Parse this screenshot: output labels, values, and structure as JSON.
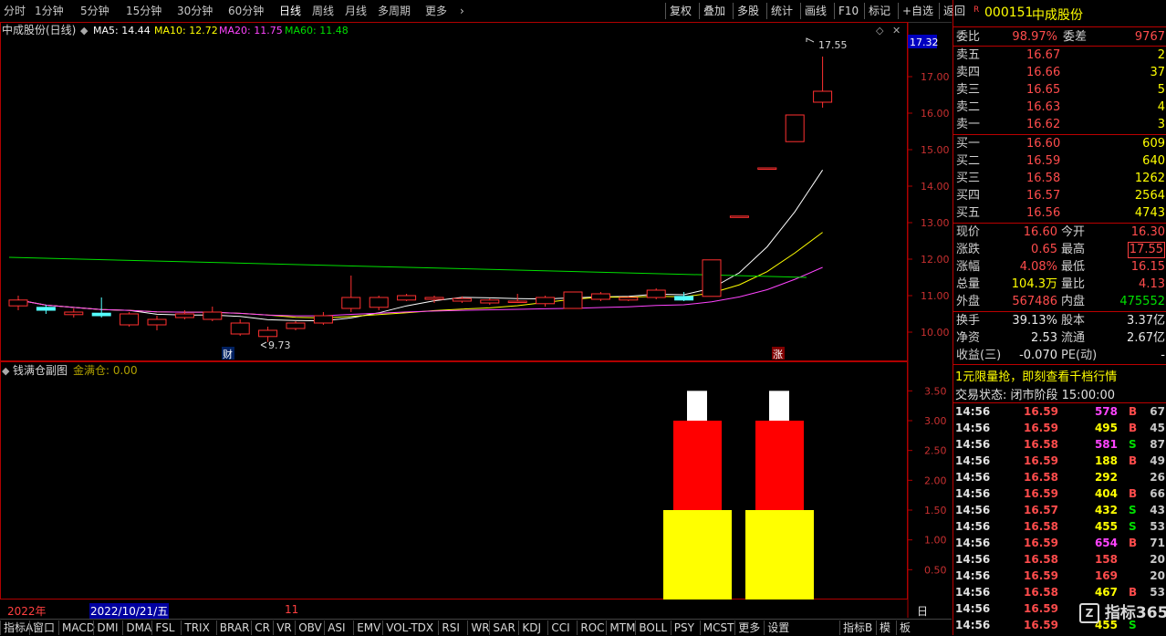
{
  "toolbar": {
    "periods": [
      "分时",
      "1分钟",
      "5分钟",
      "15分钟",
      "30分钟",
      "60分钟",
      "日线",
      "周线",
      "月线",
      "多周期",
      "更多"
    ],
    "active": "日线",
    "right": [
      "复权",
      "叠加",
      "多股",
      "统计",
      "画线",
      "F10",
      "标记",
      "+自选",
      "返回"
    ]
  },
  "main_chart": {
    "title": "中成股份(日线)",
    "ma5": "MA5: 14.44",
    "ma10": "MA10: 12.72",
    "ma20": "MA20: 11.75",
    "ma60": "MA60: 11.48",
    "price_box": "17.32",
    "high_label": "17.55",
    "low_label": "9.73",
    "cai_mark": "财",
    "zhang_mark": "涨",
    "colors": {
      "ma5": "#ffffff",
      "ma10": "#ffff00",
      "ma20": "#ff44ff",
      "ma60": "#00e000",
      "up": "#ff3030",
      "down": "#54ffff"
    }
  },
  "sub_chart": {
    "title": "钱满仓副图",
    "value": "金满仓: 0.00"
  },
  "chart_data": [
    {
      "type": "candlestick",
      "y_ticks": [
        10.0,
        11.0,
        12.0,
        13.0,
        14.0,
        15.0,
        16.0,
        17.0
      ],
      "ylim": [
        9.5,
        17.8
      ],
      "candles": [
        {
          "o": 10.72,
          "c": 10.88,
          "h": 11.0,
          "l": 10.6
        },
        {
          "o": 10.68,
          "c": 10.6,
          "h": 10.75,
          "l": 10.5
        },
        {
          "o": 10.48,
          "c": 10.55,
          "h": 10.65,
          "l": 10.4
        },
        {
          "o": 10.52,
          "c": 10.45,
          "h": 10.95,
          "l": 10.4
        },
        {
          "o": 10.2,
          "c": 10.5,
          "h": 10.55,
          "l": 10.15
        },
        {
          "o": 10.2,
          "c": 10.35,
          "h": 10.45,
          "l": 10.05
        },
        {
          "o": 10.4,
          "c": 10.5,
          "h": 10.6,
          "l": 10.35
        },
        {
          "o": 10.35,
          "c": 10.55,
          "h": 10.7,
          "l": 10.3
        },
        {
          "o": 9.95,
          "c": 10.25,
          "h": 10.35,
          "l": 9.9
        },
        {
          "o": 9.88,
          "c": 10.05,
          "h": 10.15,
          "l": 9.73
        },
        {
          "o": 10.1,
          "c": 10.25,
          "h": 10.3,
          "l": 10.05
        },
        {
          "o": 10.25,
          "c": 10.45,
          "h": 10.55,
          "l": 10.2
        },
        {
          "o": 10.65,
          "c": 10.95,
          "h": 11.55,
          "l": 10.55
        },
        {
          "o": 10.68,
          "c": 10.95,
          "h": 11.0,
          "l": 10.6
        },
        {
          "o": 10.88,
          "c": 11.0,
          "h": 11.05,
          "l": 10.85
        },
        {
          "o": 10.9,
          "c": 10.95,
          "h": 11.0,
          "l": 10.8
        },
        {
          "o": 10.85,
          "c": 10.92,
          "h": 10.98,
          "l": 10.8
        },
        {
          "o": 10.8,
          "c": 10.88,
          "h": 10.92,
          "l": 10.75
        },
        {
          "o": 10.85,
          "c": 10.85,
          "h": 11.05,
          "l": 10.8
        },
        {
          "o": 10.78,
          "c": 10.95,
          "h": 11.0,
          "l": 10.7
        },
        {
          "o": 10.65,
          "c": 11.1,
          "h": 11.1,
          "l": 10.65
        },
        {
          "o": 10.9,
          "c": 11.05,
          "h": 11.1,
          "l": 10.85
        },
        {
          "o": 10.88,
          "c": 10.95,
          "h": 10.98,
          "l": 10.85
        },
        {
          "o": 10.95,
          "c": 11.15,
          "h": 11.2,
          "l": 10.9
        },
        {
          "o": 10.98,
          "c": 10.88,
          "h": 11.1,
          "l": 10.85
        },
        {
          "o": 10.98,
          "c": 11.98,
          "h": 11.98,
          "l": 10.98
        },
        {
          "o": 13.18,
          "c": 13.18,
          "h": 13.18,
          "l": 13.18
        },
        {
          "o": 14.5,
          "c": 14.5,
          "h": 14.5,
          "l": 14.5
        },
        {
          "o": 15.22,
          "c": 15.95,
          "h": 15.95,
          "l": 15.22
        },
        {
          "o": 16.3,
          "c": 16.6,
          "h": 17.55,
          "l": 16.15
        }
      ]
    },
    {
      "type": "bar",
      "y_ticks": [
        0.5,
        1.0,
        1.5,
        2.0,
        2.5,
        3.0,
        3.5
      ],
      "ylim": [
        0,
        3.75
      ],
      "bars": [
        {
          "yellow": 1.5,
          "red_to": 3.0,
          "white_to": 3.5
        },
        {
          "yellow": 1.5,
          "red_to": 3.0,
          "white_to": 3.5
        }
      ]
    }
  ],
  "date_bar": {
    "year": "2022年",
    "date": "2022/10/21/五",
    "month": "11",
    "period": "日线"
  },
  "right_panel": {
    "code": "000151",
    "name": "中成股份",
    "r_mark": "R",
    "weibi_label": "委比",
    "weibi": "98.97%",
    "weicha_label": "委差",
    "weicha": "9767",
    "asks": [
      {
        "label": "卖五",
        "price": "16.67",
        "vol": "2"
      },
      {
        "label": "卖四",
        "price": "16.66",
        "vol": "37"
      },
      {
        "label": "卖三",
        "price": "16.65",
        "vol": "5"
      },
      {
        "label": "卖二",
        "price": "16.63",
        "vol": "4"
      },
      {
        "label": "卖一",
        "price": "16.62",
        "vol": "3"
      }
    ],
    "bids": [
      {
        "label": "买一",
        "price": "16.60",
        "vol": "609"
      },
      {
        "label": "买二",
        "price": "16.59",
        "vol": "640"
      },
      {
        "label": "买三",
        "price": "16.58",
        "vol": "1262"
      },
      {
        "label": "买四",
        "price": "16.57",
        "vol": "2564"
      },
      {
        "label": "买五",
        "price": "16.56",
        "vol": "4743"
      }
    ],
    "quote": [
      {
        "l1": "现价",
        "v1": "16.60",
        "c1": "red",
        "l2": "今开",
        "v2": "16.30",
        "c2": "red"
      },
      {
        "l1": "涨跌",
        "v1": "0.65",
        "c1": "red",
        "l2": "最高",
        "v2": "17.55",
        "c2": "red"
      },
      {
        "l1": "涨幅",
        "v1": "4.08%",
        "c1": "red",
        "l2": "最低",
        "v2": "16.15",
        "c2": "red"
      },
      {
        "l1": "总量",
        "v1": "104.3万",
        "c1": "yellow",
        "l2": "量比",
        "v2": "4.13",
        "c2": "red"
      },
      {
        "l1": "外盘",
        "v1": "567486",
        "c1": "red",
        "l2": "内盘",
        "v2": "475552",
        "c2": "green"
      }
    ],
    "fund": [
      {
        "l1": "换手",
        "v1": "39.13%",
        "l2": "股本",
        "v2": "3.37亿"
      },
      {
        "l1": "净资",
        "v1": "2.53",
        "l2": "流通",
        "v2": "2.67亿"
      },
      {
        "l1": "收益(三)",
        "v1": "-0.070",
        "l2": "PE(动)",
        "v2": "-"
      }
    ],
    "ad": "1元限量抢，即刻查看千档行情",
    "status": "交易状态: 闭市阶段 15:00:00",
    "ticks": [
      {
        "t": "14:56",
        "p": "16.59",
        "v": "578",
        "vc": "magenta",
        "s": "B",
        "sc": "red",
        "c": "67"
      },
      {
        "t": "14:56",
        "p": "16.59",
        "v": "495",
        "vc": "yellow",
        "s": "B",
        "sc": "red",
        "c": "45"
      },
      {
        "t": "14:56",
        "p": "16.58",
        "v": "581",
        "vc": "magenta",
        "s": "S",
        "sc": "green",
        "c": "87"
      },
      {
        "t": "14:56",
        "p": "16.59",
        "v": "188",
        "vc": "yellow",
        "s": "B",
        "sc": "red",
        "c": "49"
      },
      {
        "t": "14:56",
        "p": "16.58",
        "v": "292",
        "vc": "yellow",
        "s": "",
        "sc": "red",
        "c": "26"
      },
      {
        "t": "14:56",
        "p": "16.59",
        "v": "404",
        "vc": "yellow",
        "s": "B",
        "sc": "red",
        "c": "66"
      },
      {
        "t": "14:56",
        "p": "16.57",
        "v": "432",
        "vc": "yellow",
        "s": "S",
        "sc": "green",
        "c": "43"
      },
      {
        "t": "14:56",
        "p": "16.58",
        "v": "455",
        "vc": "yellow",
        "s": "S",
        "sc": "green",
        "c": "53"
      },
      {
        "t": "14:56",
        "p": "16.59",
        "v": "654",
        "vc": "magenta",
        "s": "B",
        "sc": "red",
        "c": "71"
      },
      {
        "t": "14:56",
        "p": "16.58",
        "v": "158",
        "vc": "red",
        "s": "",
        "sc": "red",
        "c": "20"
      },
      {
        "t": "14:56",
        "p": "16.59",
        "v": "169",
        "vc": "red",
        "s": "",
        "sc": "red",
        "c": "20"
      },
      {
        "t": "14:56",
        "p": "16.58",
        "v": "467",
        "vc": "yellow",
        "s": "B",
        "sc": "red",
        "c": "53"
      },
      {
        "t": "14:56",
        "p": "16.59",
        "v": "",
        "vc": "yellow",
        "s": "",
        "sc": "red",
        "c": ""
      },
      {
        "t": "14:56",
        "p": "16.59",
        "v": "455",
        "vc": "yellow",
        "s": "S",
        "sc": "green",
        "c": ""
      }
    ],
    "watermark": "指标365"
  },
  "bottom_bar": {
    "left": [
      "指标A",
      "窗口",
      "MACD",
      "DMI",
      "DMA",
      "FSL",
      "TRIX",
      "BRAR",
      "CR",
      "VR",
      "OBV",
      "ASI",
      "EMV",
      "VOL-TDX",
      "RSI",
      "WR",
      "SAR",
      "KDJ",
      "CCI",
      "ROC",
      "MTM",
      "BOLL",
      "PSY",
      "MCST",
      "更多",
      "设置"
    ],
    "right": [
      "指标B",
      "模",
      "板"
    ]
  }
}
